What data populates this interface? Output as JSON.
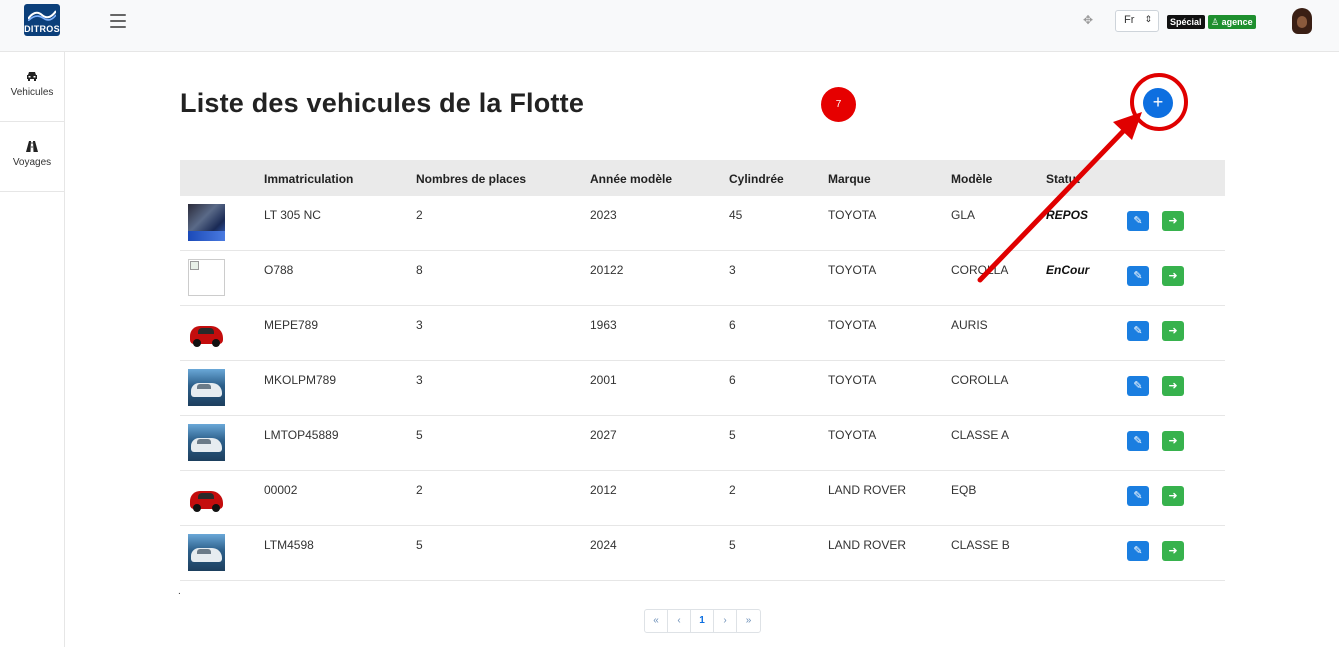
{
  "brand": {
    "logo_text": "DITROS"
  },
  "topbar": {
    "language": "Fr",
    "badge_special": "Spécial",
    "badge_agence": "agence"
  },
  "sidebar": {
    "items": [
      {
        "label": "Vehicules",
        "icon": "car-icon"
      },
      {
        "label": "Voyages",
        "icon": "road-icon"
      }
    ]
  },
  "page": {
    "title": "Liste des vehicules de la Flotte",
    "count": "7",
    "add_label": "+"
  },
  "table": {
    "headers": [
      "Immatriculation",
      "Nombres de places",
      "Année modèle",
      "Cylindrée",
      "Marque",
      "Modèle",
      "Statut"
    ],
    "rows": [
      {
        "image": "photo",
        "immat": "LT 305 NC",
        "places": "2",
        "annee": "2023",
        "cylindree": "45",
        "marque": "TOYOTA",
        "modele": "GLA",
        "statut": "REPOS"
      },
      {
        "image": "broken",
        "immat": "O788",
        "places": "8",
        "annee": "20122",
        "cylindree": "3",
        "marque": "TOYOTA",
        "modele": "COROLLA",
        "statut": "EnCour"
      },
      {
        "image": "red-car",
        "immat": "MEPE789",
        "places": "3",
        "annee": "1963",
        "cylindree": "6",
        "marque": "TOYOTA",
        "modele": "AURIS",
        "statut": ""
      },
      {
        "image": "silver-car",
        "immat": "MKOLPM789",
        "places": "3",
        "annee": "2001",
        "cylindree": "6",
        "marque": "TOYOTA",
        "modele": "COROLLA",
        "statut": ""
      },
      {
        "image": "silver-car",
        "immat": "LMTOP45889",
        "places": "5",
        "annee": "2027",
        "cylindree": "5",
        "marque": "TOYOTA",
        "modele": "CLASSE A",
        "statut": ""
      },
      {
        "image": "red-car",
        "immat": "00002",
        "places": "2",
        "annee": "2012",
        "cylindree": "2",
        "marque": "LAND ROVER",
        "modele": "EQB",
        "statut": ""
      },
      {
        "image": "silver-car",
        "immat": "LTM4598",
        "places": "5",
        "annee": "2024",
        "cylindree": "5",
        "marque": "LAND ROVER",
        "modele": "CLASSE B",
        "statut": ""
      }
    ]
  },
  "footer_dot": ".",
  "pagination": {
    "first": "«",
    "prev": "‹",
    "current": "1",
    "next": "›",
    "last": "»"
  },
  "colors": {
    "primary": "#0d6fe0",
    "success": "#37b24d",
    "badge_red": "#e60000",
    "annotation": "#e00000"
  }
}
